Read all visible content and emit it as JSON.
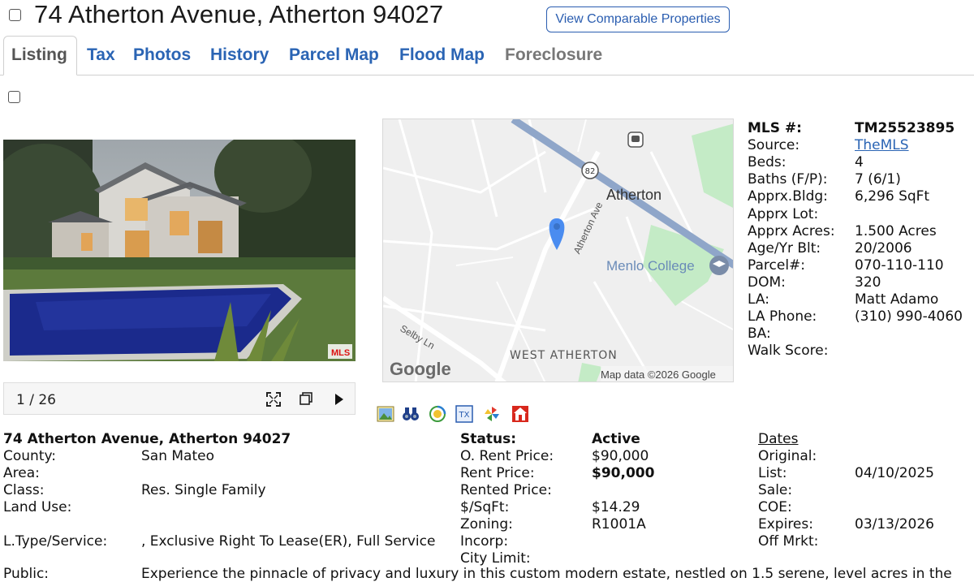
{
  "header": {
    "title": "74 Atherton Avenue, Atherton 94027",
    "comparable_button": "View Comparable Properties"
  },
  "tabs": [
    {
      "label": "Listing"
    },
    {
      "label": "Tax"
    },
    {
      "label": "Photos"
    },
    {
      "label": "History"
    },
    {
      "label": "Parcel Map"
    },
    {
      "label": "Flood Map"
    },
    {
      "label": "Foreclosure"
    }
  ],
  "photo": {
    "counter": "1 / 26",
    "watermark": "MLS"
  },
  "map": {
    "city_label": "Atherton",
    "college_label": "Menlo College",
    "street_label": "Atherton Ave",
    "road_label": "Selby Ln",
    "area_label": "WEST ATHERTON",
    "route_number": "82",
    "logo": "Google",
    "attribution": "Map data ©2026 Google"
  },
  "mls": [
    {
      "label": "MLS #:",
      "value": "TM25523895"
    },
    {
      "label": "Source:",
      "value": "TheMLS"
    },
    {
      "label": "Beds:",
      "value": "4"
    },
    {
      "label": "Baths (F/P):",
      "value": "7 (6/1)"
    },
    {
      "label": "Apprx.Bldg:",
      "value": "6,296 SqFt"
    },
    {
      "label": "Apprx Lot:",
      "value": ""
    },
    {
      "label": "Apprx Acres:",
      "value": "1.500 Acres"
    },
    {
      "label": "Age/Yr Blt:",
      "value": "20/2006"
    },
    {
      "label": "Parcel#:",
      "value": "070-110-110"
    },
    {
      "label": "DOM:",
      "value": "320"
    },
    {
      "label": "LA:",
      "value": "Matt Adamo"
    },
    {
      "label": "LA Phone:",
      "value": "(310) 990-4060"
    },
    {
      "label": "BA:",
      "value": ""
    },
    {
      "label": "Walk Score:",
      "value": ""
    }
  ],
  "details": {
    "address": "74 Atherton Avenue, Atherton 94027",
    "left": [
      {
        "label": "County:",
        "value": "San Mateo"
      },
      {
        "label": "Area:",
        "value": ""
      },
      {
        "label": "Class:",
        "value": "Res. Single Family"
      },
      {
        "label": "Land Use:",
        "value": ""
      },
      {
        "label": "",
        "value": ""
      },
      {
        "label": "L.Type/Service:",
        "value": ", Exclusive Right To Lease(ER), Full Service"
      },
      {
        "label": "",
        "value": ""
      },
      {
        "label": "Public:",
        "value": "Experience the pinnacle of privacy and luxury in this custom modern estate, nestled on 1.5 serene, level acres in the"
      }
    ],
    "status_label": "Status:",
    "status_value": "Active",
    "middle": [
      {
        "label": "O. Rent Price:",
        "value": "$90,000"
      },
      {
        "label": "Rent Price:",
        "value": "$90,000"
      },
      {
        "label": "Rented Price:",
        "value": ""
      },
      {
        "label": "$/SqFt:",
        "value": "$14.29"
      },
      {
        "label": "Zoning:",
        "value": "R1001A"
      },
      {
        "label": "Incorp:",
        "value": ""
      },
      {
        "label": "City Limit:",
        "value": ""
      }
    ],
    "dates_heading": "Dates",
    "dates": [
      {
        "label": "Original:",
        "value": ""
      },
      {
        "label": "List:",
        "value": "04/10/2025"
      },
      {
        "label": "Sale:",
        "value": ""
      },
      {
        "label": "COE:",
        "value": ""
      },
      {
        "label": "Expires:",
        "value": "03/13/2026"
      },
      {
        "label": "Off Mrkt:",
        "value": ""
      }
    ]
  },
  "toolbar_icons": [
    "photo-icon",
    "binoculars-icon",
    "walk-score-icon",
    "tax-icon",
    "pinwheel-icon",
    "home-value-icon"
  ],
  "colors": {
    "link": "#2a64b4",
    "tab_active": "#555555",
    "map_road": "#8fa6c9",
    "map_park": "#c4ebc6",
    "pin": "#4a8cf0"
  }
}
